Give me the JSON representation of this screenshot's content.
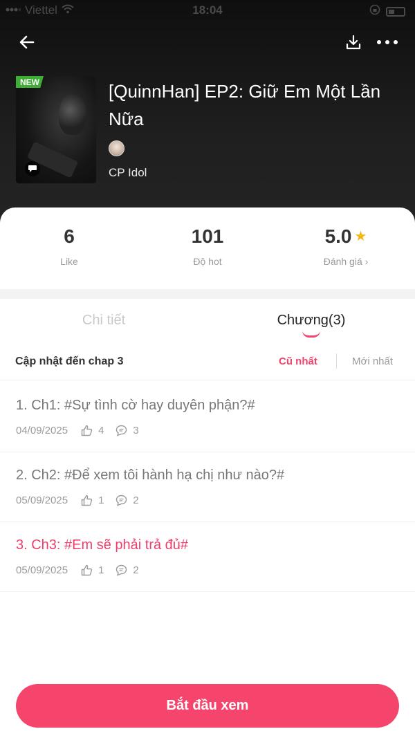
{
  "status": {
    "carrier": "Viettel",
    "time": "18:04"
  },
  "header": {
    "icons": [
      "back-arrow-icon",
      "download-icon",
      "more-icon"
    ]
  },
  "book": {
    "badge": "NEW",
    "title": "[QuinnHan] EP2: Giữ Em Một Lần Nữa",
    "author": "CP Idol"
  },
  "stats": {
    "like": {
      "value": "6",
      "label": "Like"
    },
    "hot": {
      "value": "101",
      "label": "Độ hot"
    },
    "rating": {
      "value": "5.0",
      "label": "Đánh giá ›"
    }
  },
  "tabs": {
    "detail": "Chi tiết",
    "chapters": "Chương(3)"
  },
  "list": {
    "update_text": "Cập nhật đến chap 3",
    "sort_old": "Cũ nhất",
    "sort_new": "Mới nhất"
  },
  "chapters": [
    {
      "title": "1. Ch1: #Sự tình cờ hay duyên phận?#",
      "date": "04/09/2025",
      "likes": "4",
      "comments": "3"
    },
    {
      "title": "2. Ch2: #Để xem tôi hành hạ chị như nào?#",
      "date": "05/09/2025",
      "likes": "1",
      "comments": "2"
    },
    {
      "title": "3. Ch3: #Em sẽ phải trả đủ#",
      "date": "05/09/2025",
      "likes": "1",
      "comments": "2"
    }
  ],
  "cta": {
    "label": "Bắt đầu xem"
  },
  "colors": {
    "accent": "#f5456c",
    "badge": "#3fae35",
    "star": "#f6b40e"
  }
}
